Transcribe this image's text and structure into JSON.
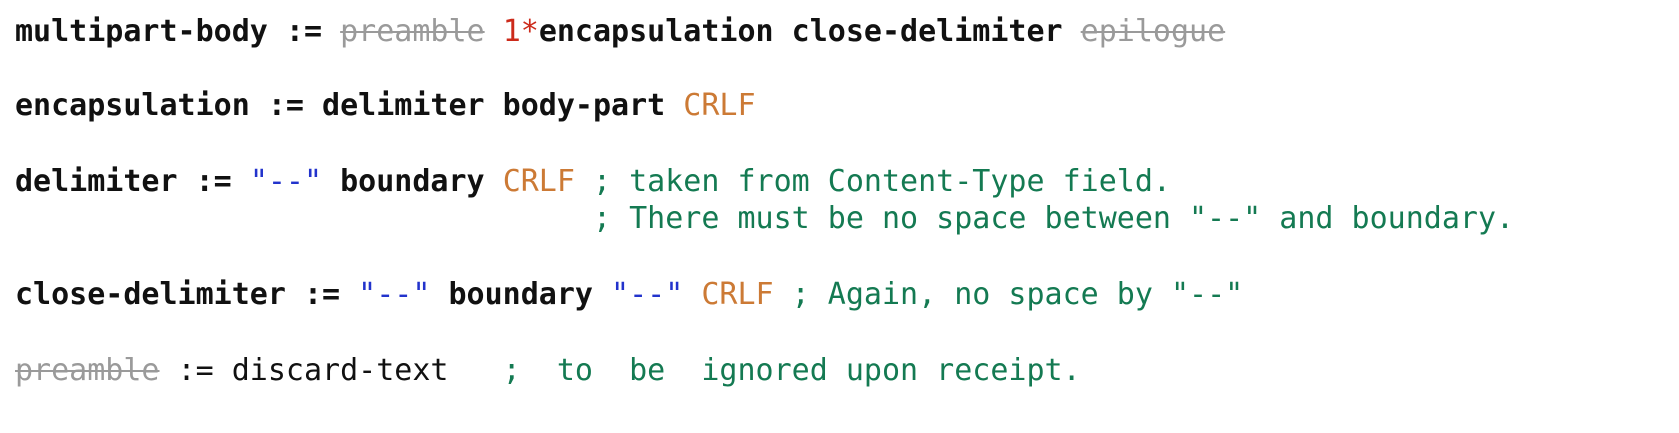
{
  "colors": {
    "text": "#111111",
    "deprecated": "#9a9a9a",
    "repeat": "#cc2a1a",
    "literal": "#2233cc",
    "terminal": "#cc7a35",
    "comment": "#147a52"
  },
  "lines": [
    {
      "name": "rule-multipart-body",
      "segments": [
        {
          "text": "multipart-body",
          "style": "bold"
        },
        {
          "text": " := ",
          "style": "bold"
        },
        {
          "text": "preamble",
          "style": "deprecated"
        },
        {
          "text": " ",
          "style": "plain"
        },
        {
          "text": "1*",
          "style": "repeat"
        },
        {
          "text": "encapsulation close-delimiter",
          "style": "bold"
        },
        {
          "text": " ",
          "style": "plain"
        },
        {
          "text": "epilogue",
          "style": "deprecated"
        }
      ]
    },
    {
      "name": "rule-encapsulation",
      "segments": [
        {
          "text": "encapsulation := delimiter body-part",
          "style": "bold"
        },
        {
          "text": " ",
          "style": "plain"
        },
        {
          "text": "CRLF",
          "style": "terminal"
        }
      ]
    },
    {
      "name": "rule-delimiter",
      "segments": [
        {
          "text": "delimiter := ",
          "style": "bold"
        },
        {
          "text": "\"--\"",
          "style": "literal"
        },
        {
          "text": " boundary ",
          "style": "bold"
        },
        {
          "text": "CRLF",
          "style": "terminal"
        },
        {
          "text": " ; taken from Content-Type field.",
          "style": "comment"
        }
      ]
    },
    {
      "name": "rule-delimiter-comment",
      "segments": [
        {
          "text": "                                ",
          "style": "plain"
        },
        {
          "text": "; There must be no space between \"--\" and boundary.",
          "style": "comment"
        }
      ]
    },
    {
      "name": "rule-close-delimiter",
      "segments": [
        {
          "text": "close-delimiter := ",
          "style": "bold"
        },
        {
          "text": "\"--\"",
          "style": "literal"
        },
        {
          "text": " boundary ",
          "style": "bold"
        },
        {
          "text": "\"--\"",
          "style": "literal"
        },
        {
          "text": " ",
          "style": "plain"
        },
        {
          "text": "CRLF",
          "style": "terminal"
        },
        {
          "text": " ; Again, no space by \"--\"",
          "style": "comment"
        }
      ]
    },
    {
      "name": "rule-preamble",
      "segments": [
        {
          "text": "preamble",
          "style": "deprecated"
        },
        {
          "text": " := discard-text   ",
          "style": "plain"
        },
        {
          "text": ";  to  be  ignored upon receipt.",
          "style": "comment"
        }
      ]
    }
  ]
}
